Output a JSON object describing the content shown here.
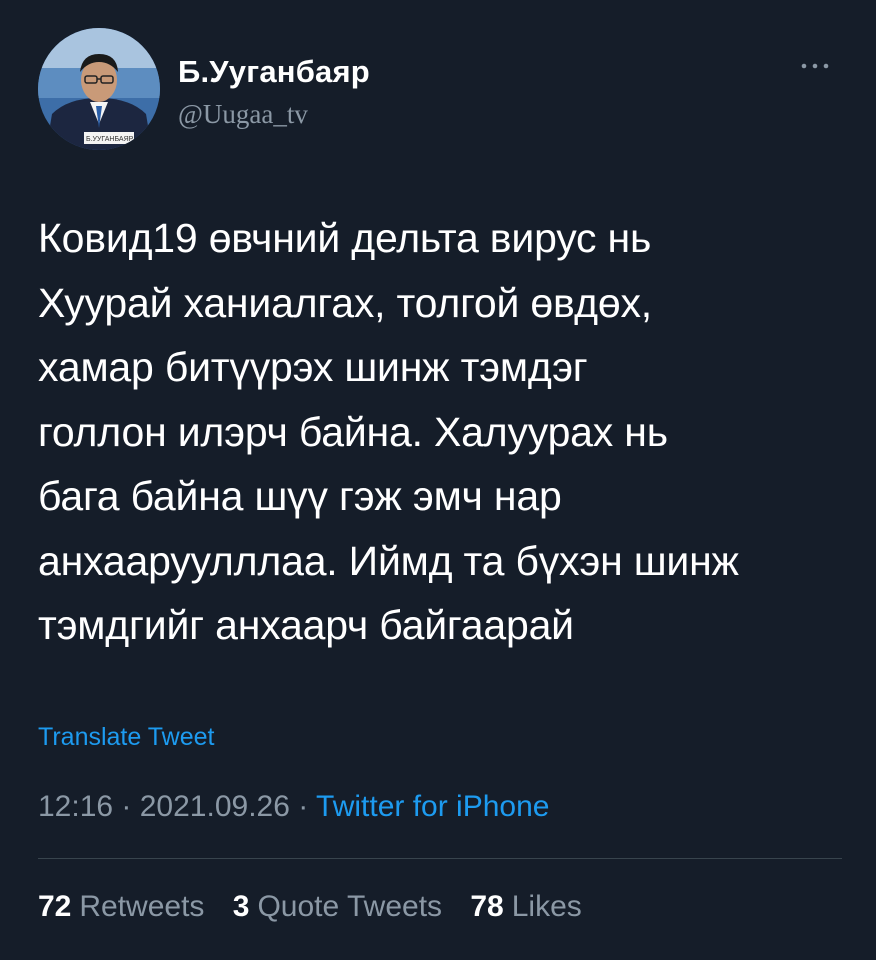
{
  "user": {
    "display_name": "Б.Ууганбаяр",
    "handle": "@Uugaa_tv",
    "avatar_caption": "Б.УУГАНБАЯР"
  },
  "tweet": {
    "text": "Ковид19 өвчний дельта вирус нь\nХуурай ханиалгах, толгой өвдөх,\nхамар битүүрэх шинж тэмдэг\nголлон илэрч байна. Халуурах нь\nбага байна шүү гэж эмч нар\nанхааруулллаа. Иймд та бүхэн шинж\nтэмдгийг анхаарч байгаарай",
    "translate_label": "Translate Tweet",
    "time": "12:16",
    "separator_1": " · ",
    "date": "2021.09.26",
    "separator_2": " · ",
    "source": "Twitter for iPhone"
  },
  "stats": {
    "retweets_count": "72",
    "retweets_label": "Retweets",
    "quotes_count": "3",
    "quotes_label": "Quote Tweets",
    "likes_count": "78",
    "likes_label": "Likes"
  },
  "icons": {
    "more": "more-horizontal-icon"
  },
  "colors": {
    "background": "#151d29",
    "text_primary": "#ffffff",
    "text_secondary": "#8b98a5",
    "link": "#1d9bf0",
    "divider": "#38444d"
  }
}
